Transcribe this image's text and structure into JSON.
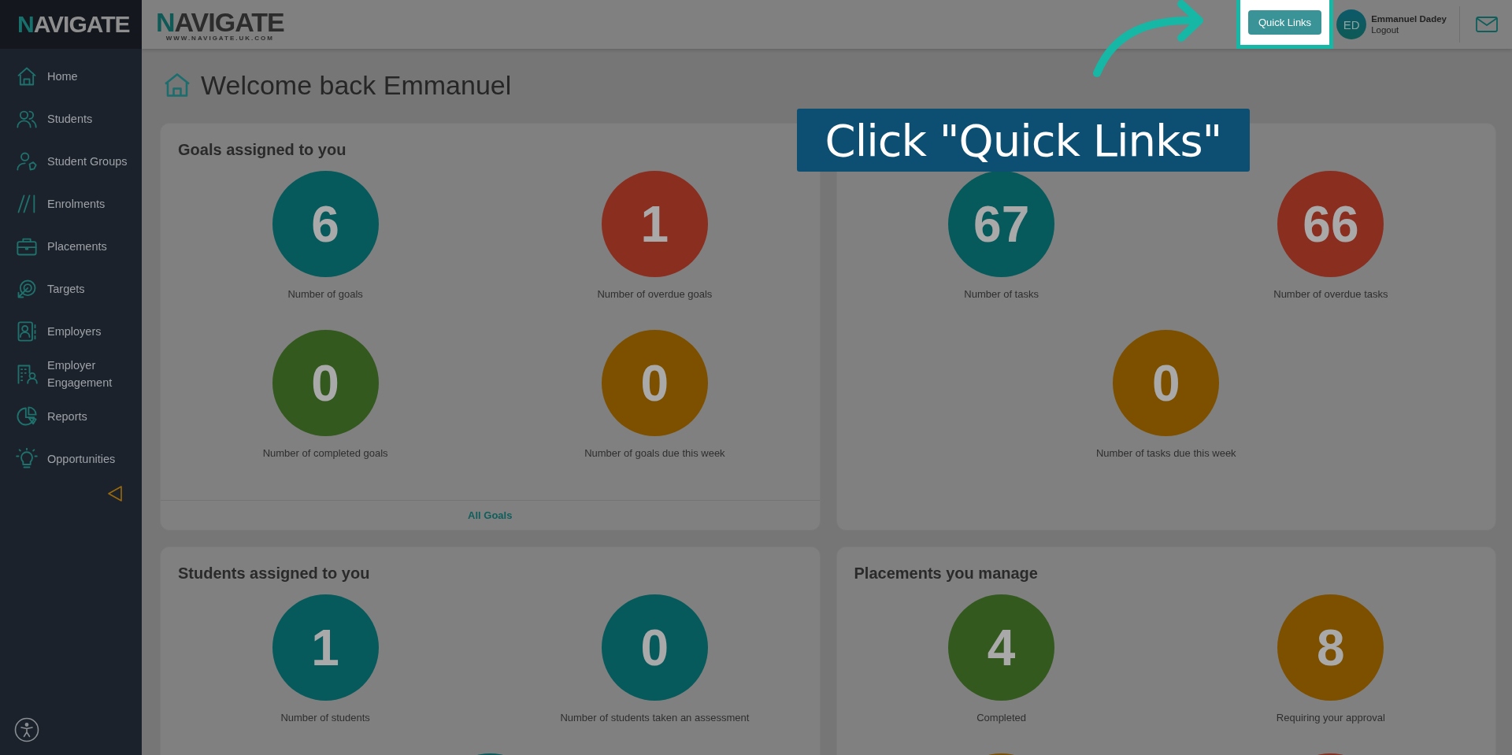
{
  "sidebar": {
    "logo": "NAVIGATE",
    "items": [
      {
        "label": "Home"
      },
      {
        "label": "Students"
      },
      {
        "label": "Student Groups"
      },
      {
        "label": "Enrolments"
      },
      {
        "label": "Placements"
      },
      {
        "label": "Targets"
      },
      {
        "label": "Employers"
      },
      {
        "label": "Employer Engagement"
      },
      {
        "label": "Reports"
      },
      {
        "label": "Opportunities"
      }
    ]
  },
  "header": {
    "logo": "NAVIGATE",
    "tagline": "WWW.NAVIGATE.UK.COM",
    "quick_links": "Quick Links",
    "user": {
      "initials": "ED",
      "name": "Emmanuel Dadey",
      "logout": "Logout"
    }
  },
  "page_title": "Welcome back Emmanuel",
  "cards": [
    {
      "title": "Goals assigned to you",
      "footer_link": "All Goals",
      "stats": [
        {
          "value": "6",
          "label": "Number of goals",
          "color": "#075a5c"
        },
        {
          "value": "1",
          "label": "Number of overdue goals",
          "color": "#8a2e20"
        },
        {
          "value": "0",
          "label": "Number of completed goals",
          "color": "#33591f"
        },
        {
          "value": "0",
          "label": "Number of goals due this week",
          "color": "#7d5000"
        }
      ]
    },
    {
      "stats": [
        {
          "value": "67",
          "label": "Number of tasks",
          "color": "#075a5c"
        },
        {
          "value": "66",
          "label": "Number of overdue tasks",
          "color": "#8a2e20"
        },
        {
          "value": "0",
          "label": "Number of tasks due this week",
          "color": "#7d5000"
        }
      ]
    },
    {
      "title": "Students assigned to you",
      "stats": [
        {
          "value": "1",
          "label": "Number of students",
          "color": "#075a5c"
        },
        {
          "value": "0",
          "label": "Number of students taken an assessment",
          "color": "#075a5c"
        },
        {
          "color": "#075a5c"
        }
      ]
    },
    {
      "title": "Placements you manage",
      "stats": [
        {
          "value": "4",
          "label": "Completed",
          "color": "#33591f"
        },
        {
          "value": "8",
          "label": "Requiring your approval",
          "color": "#7d5000"
        },
        {
          "color": "#7d5000"
        },
        {
          "color": "#8a2e20"
        }
      ]
    }
  ],
  "callout": {
    "text": "Click \"Quick Links\""
  }
}
